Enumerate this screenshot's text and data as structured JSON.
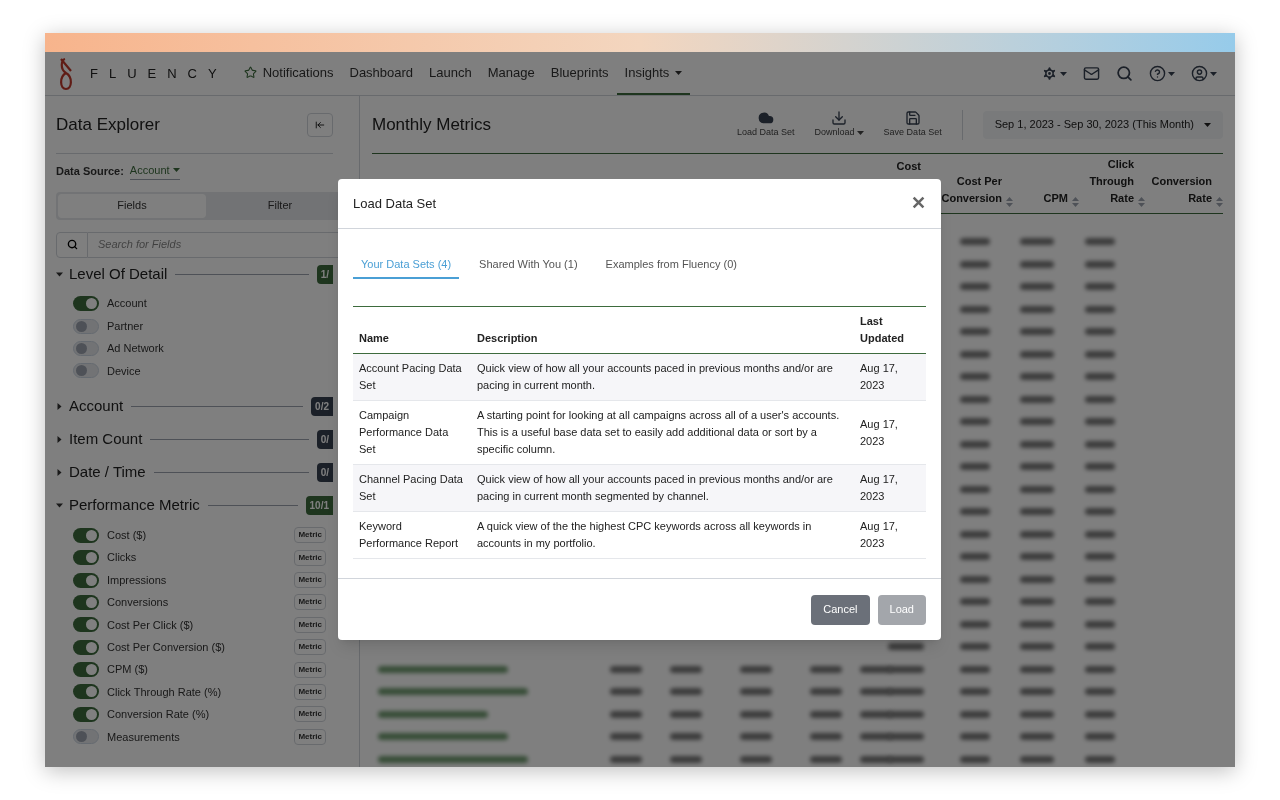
{
  "nav": {
    "logo_text": "FLUENCY",
    "items": [
      {
        "label": "Notifications",
        "kind": "star",
        "selected": false
      },
      {
        "label": "Dashboard",
        "kind": "plain",
        "selected": false
      },
      {
        "label": "Launch",
        "kind": "plain",
        "selected": false
      },
      {
        "label": "Manage",
        "kind": "plain",
        "selected": false
      },
      {
        "label": "Blueprints",
        "kind": "plain",
        "selected": false
      },
      {
        "label": "Insights",
        "kind": "menu",
        "selected": true
      }
    ]
  },
  "sidebar": {
    "title": "Data Explorer",
    "data_source_label": "Data Source:",
    "data_source_value": "Account",
    "tabs": [
      {
        "label": "Fields",
        "selected": true
      },
      {
        "label": "Filter",
        "selected": false
      }
    ],
    "search": {
      "placeholder": "Search for Fields"
    },
    "sections": [
      {
        "title": "Level Of Detail",
        "expanded": true,
        "count": "1/",
        "active": true,
        "items": [
          {
            "label": "Account",
            "on": true
          },
          {
            "label": "Partner",
            "on": false
          },
          {
            "label": "Ad Network",
            "on": false
          },
          {
            "label": "Device",
            "on": false
          }
        ]
      },
      {
        "title": "Account",
        "expanded": false,
        "count": "0/2",
        "active": false
      },
      {
        "title": "Item Count",
        "expanded": false,
        "count": "0/",
        "active": false
      },
      {
        "title": "Date / Time",
        "expanded": false,
        "count": "0/",
        "active": false
      },
      {
        "title": "Performance Metric",
        "expanded": true,
        "count": "10/1",
        "active": true,
        "items": [
          {
            "label": "Cost ($)",
            "on": true,
            "tag": "Metric"
          },
          {
            "label": "Clicks",
            "on": true,
            "tag": "Metric"
          },
          {
            "label": "Impressions",
            "on": true,
            "tag": "Metric"
          },
          {
            "label": "Conversions",
            "on": true,
            "tag": "Metric"
          },
          {
            "label": "Cost Per Click ($)",
            "on": true,
            "tag": "Metric"
          },
          {
            "label": "Cost Per Conversion ($)",
            "on": true,
            "tag": "Metric"
          },
          {
            "label": "CPM ($)",
            "on": true,
            "tag": "Metric"
          },
          {
            "label": "Click Through Rate (%)",
            "on": true,
            "tag": "Metric"
          },
          {
            "label": "Conversion Rate (%)",
            "on": true,
            "tag": "Metric"
          },
          {
            "label": "Measurements",
            "on": false,
            "tag": "Metric"
          }
        ]
      }
    ]
  },
  "main": {
    "title": "Monthly Metrics",
    "toolbar": [
      {
        "label": "Load Data Set",
        "kind": "cloud"
      },
      {
        "label": "Download",
        "kind": "download"
      },
      {
        "label": "Save Data Set",
        "kind": "save"
      }
    ],
    "date_range": "Sep 1, 2023 - Sep 30, 2023 (This Month)",
    "columns": [
      {
        "lines": [
          "Cost"
        ],
        "sortable": false
      },
      {
        "lines": [
          "Cost Per",
          "Conversion"
        ],
        "sortable": true
      },
      {
        "lines": [
          "CPM"
        ],
        "sortable": true
      },
      {
        "lines": [
          "Click",
          "Through",
          "Rate"
        ],
        "sortable": true
      },
      {
        "lines": [
          "Conversion",
          "Rate"
        ],
        "sortable": true
      }
    ]
  },
  "modal": {
    "title": "Load Data Set",
    "close": "✕",
    "tabs": [
      {
        "label": "Your Data Sets (4)",
        "selected": true
      },
      {
        "label": "Shared With You (1)",
        "selected": false
      },
      {
        "label": "Examples from Fluency (0)",
        "selected": false
      }
    ],
    "columns": [
      "Name",
      "Description",
      "Last Updated"
    ],
    "rows": [
      {
        "name": "Account Pacing Data Set",
        "description": "Quick view of how all your accounts paced in previous months and/or are pacing in current month.",
        "updated": "Aug 17, 2023"
      },
      {
        "name": "Campaign Performance Data Set",
        "description": "A starting point for looking at all campaigns across all of a user's accounts. This is a useful base data set to easily add additional data or sort by a specific column.",
        "updated": "Aug 17, 2023"
      },
      {
        "name": "Channel Pacing Data Set",
        "description": "Quick view of how all your accounts paced in previous months and/or are pacing in current month segmented by channel.",
        "updated": "Aug 17, 2023"
      },
      {
        "name": "Keyword Performance Report",
        "description": "A quick view of the the highest CPC keywords across all keywords in accounts in my portfolio.",
        "updated": "Aug 17, 2023"
      }
    ],
    "buttons": [
      {
        "label": "Cancel",
        "disabled": false
      },
      {
        "label": "Load",
        "disabled": true
      }
    ]
  }
}
